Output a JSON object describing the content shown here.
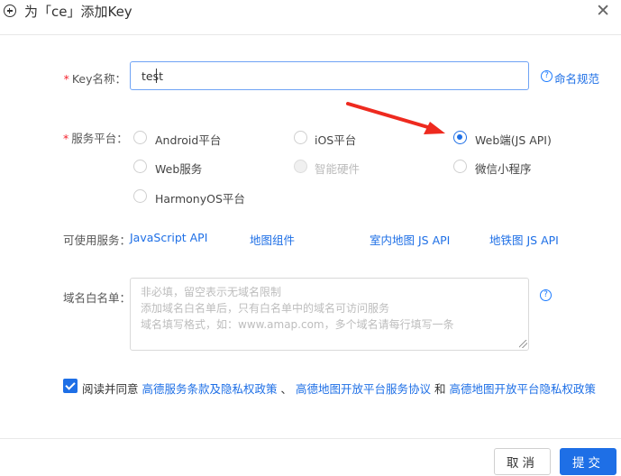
{
  "header": {
    "title": "为「ce」添加Key",
    "close_symbol": "✕"
  },
  "form": {
    "key_name": {
      "required_mark": "*",
      "label": "Key名称：",
      "value": "test",
      "help_link": "命名规范"
    },
    "platform": {
      "required_mark": "*",
      "label": "服务平台：",
      "options": [
        {
          "label": "Android平台",
          "checked": false,
          "disabled": false
        },
        {
          "label": "iOS平台",
          "checked": false,
          "disabled": false
        },
        {
          "label": "Web端(JS API)",
          "checked": true,
          "disabled": false
        },
        {
          "label": "Web服务",
          "checked": false,
          "disabled": false
        },
        {
          "label": "智能硬件",
          "checked": false,
          "disabled": true
        },
        {
          "label": "微信小程序",
          "checked": false,
          "disabled": false
        },
        {
          "label": "HarmonyOS平台",
          "checked": false,
          "disabled": false
        }
      ]
    },
    "services": {
      "label": "可使用服务：",
      "items": [
        "JavaScript API",
        "地图组件",
        "室内地图 JS API",
        "地铁图 JS API"
      ]
    },
    "whitelist": {
      "label": "域名白名单：",
      "placeholder_lines": [
        "非必填，留空表示无域名限制",
        "添加域名白名单后，只有白名单中的域名可访问服务",
        "域名填写格式，如：www.amap.com，多个域名请每行填写一条"
      ],
      "help_symbol": "?"
    },
    "agreement": {
      "checked": true,
      "prefix": "阅读并同意",
      "link1": "高德服务条款及隐私权政策",
      "sep": "、",
      "link2": "高德地图开放平台服务协议",
      "and": "和",
      "link3": "高德地图开放平台隐私权政策"
    }
  },
  "footer": {
    "cancel_label": "取消",
    "submit_label": "提交"
  },
  "colors": {
    "primary": "#1e6fe6",
    "required": "#f5222d",
    "arrow": "#ee2a1f"
  }
}
